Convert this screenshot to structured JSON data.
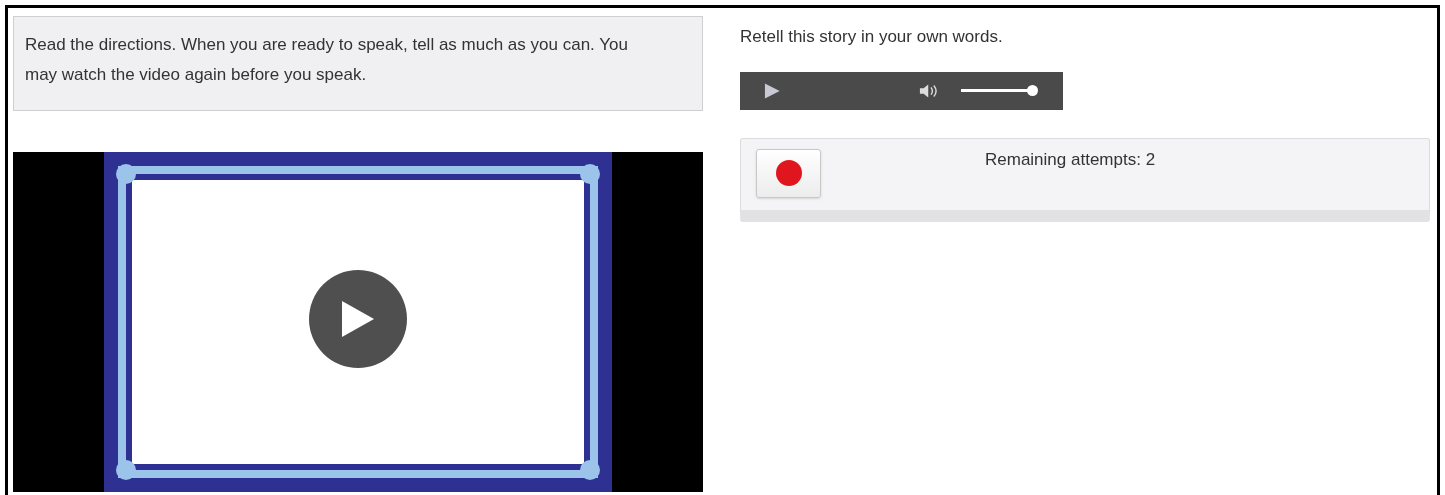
{
  "directions": "Read the directions. When you are ready to speak, tell as much as you can. You may watch the video again before you speak.",
  "prompt": "Retell this story in your own words.",
  "audio_player": {
    "volume": {
      "level": 1
    }
  },
  "recorder": {
    "remaining_attempts": "Remaining attempts: 2"
  }
}
